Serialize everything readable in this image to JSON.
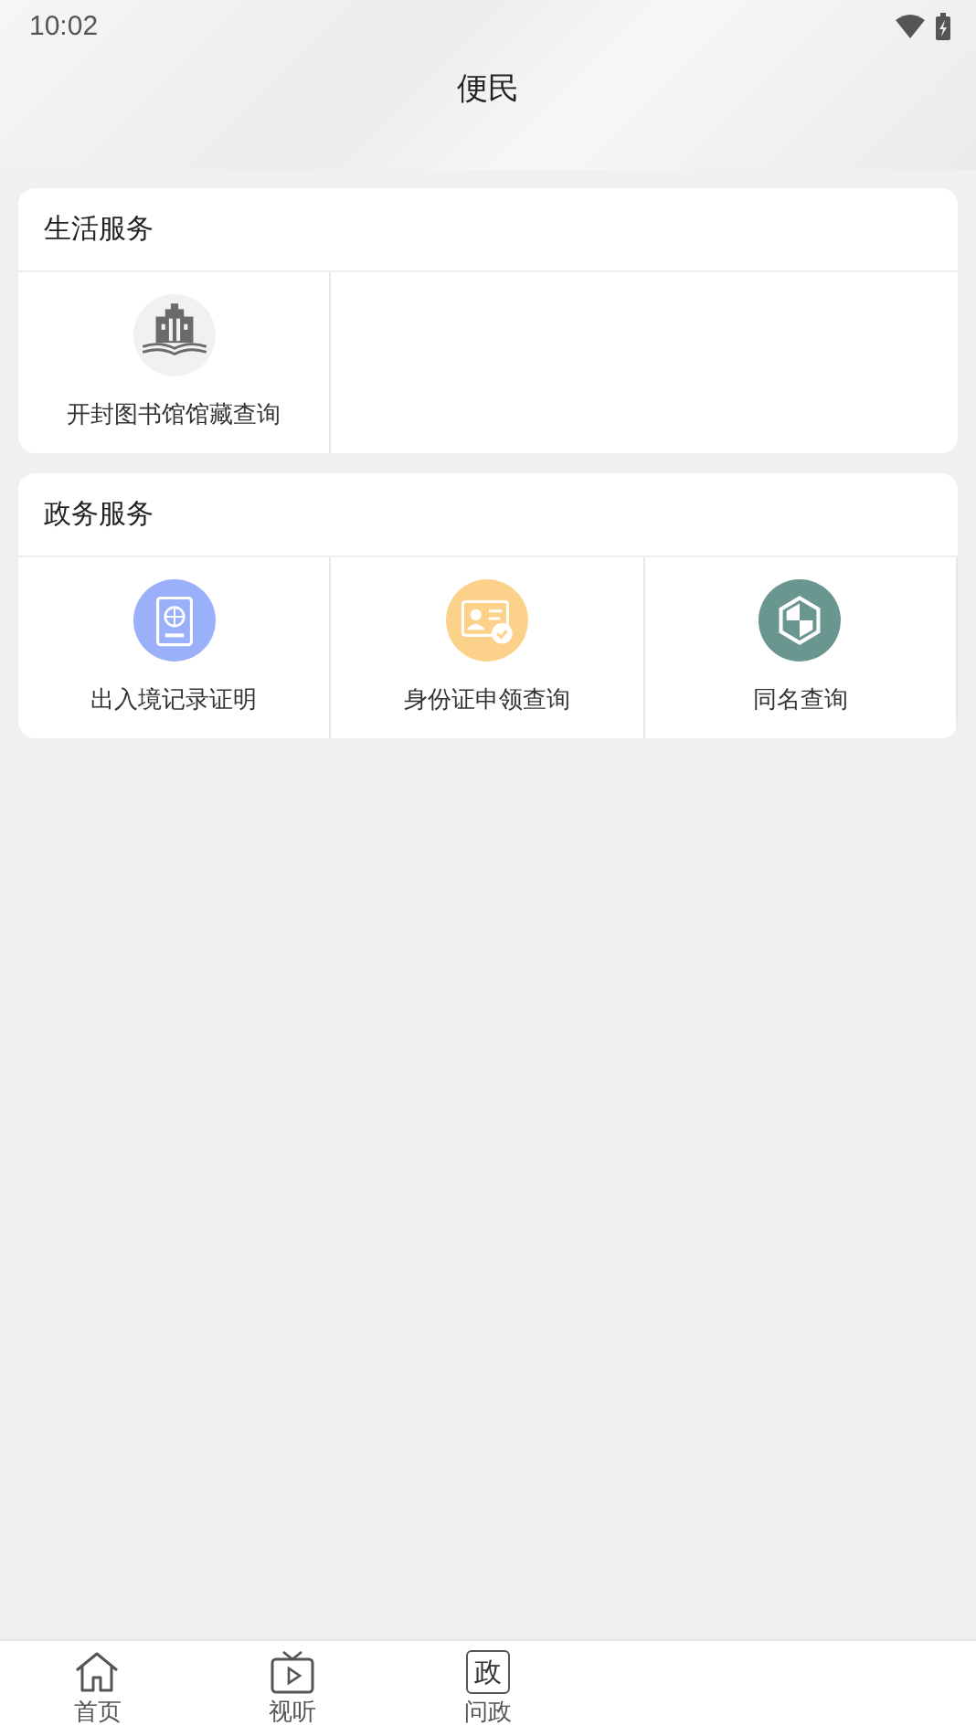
{
  "status_bar": {
    "time": "10:02"
  },
  "header": {
    "title": "便民"
  },
  "sections": [
    {
      "title": "生活服务",
      "items": [
        {
          "label": "开封图书馆馆藏查询",
          "kind": "library"
        }
      ]
    },
    {
      "title": "政务服务",
      "items": [
        {
          "label": "出入境记录证明",
          "kind": "passport"
        },
        {
          "label": "身份证申领查询",
          "kind": "idcard"
        },
        {
          "label": "同名查询",
          "kind": "shield"
        }
      ]
    }
  ],
  "bottom_nav": [
    {
      "label": "首页",
      "kind": "home"
    },
    {
      "label": "视听",
      "kind": "tv"
    },
    {
      "label": "问政",
      "kind": "text",
      "icon_text": "政"
    }
  ]
}
